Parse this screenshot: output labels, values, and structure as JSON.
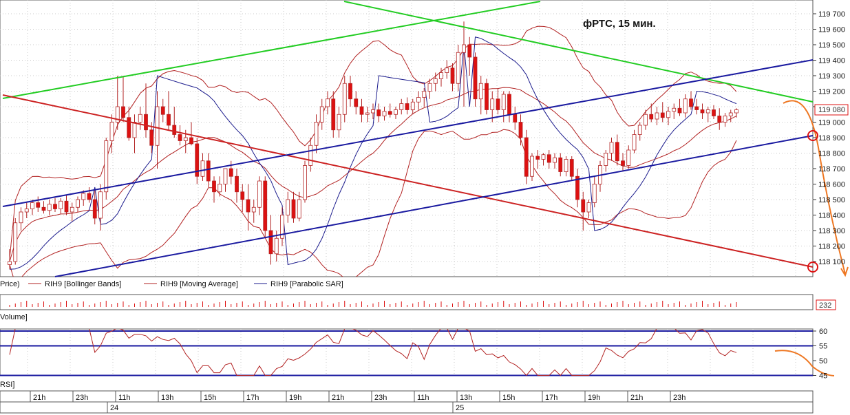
{
  "chart_data": {
    "type": "candlestick",
    "title": "фРТС, 15 мин.",
    "instrument": "RIH9",
    "price_axis_labels": [
      "119 700",
      "119 600",
      "119 500",
      "119 400",
      "119 300",
      "119 200",
      "119 100",
      "119 000",
      "118 900",
      "118 800",
      "118 700",
      "118 600",
      "118 500",
      "118 400",
      "118 300",
      "118 200",
      "118 100"
    ],
    "price_axis_values": [
      119700,
      119600,
      119500,
      119400,
      119300,
      119200,
      119100,
      119000,
      118900,
      118800,
      118700,
      118600,
      118500,
      118400,
      118300,
      118200,
      118100
    ],
    "last_price": "119 080",
    "last_volume": "232",
    "legend": [
      {
        "label": "Price)",
        "color": "#000000"
      },
      {
        "label": "RIH9 [Bollinger Bands]",
        "color": "#b22222"
      },
      {
        "label": "RIH9 [Moving Average]",
        "color": "#b22222"
      },
      {
        "label": "RIH9 [Parabolic SAR]",
        "color": "#1a1a8c"
      }
    ],
    "volume_label": "Volume]",
    "rsi_label": "RSI]",
    "rsi_axis_labels": [
      "60",
      "55",
      "50",
      "45"
    ],
    "rsi_axis_values": [
      60,
      55,
      50,
      45
    ],
    "time_labels": [
      "21h",
      "23h",
      "11h",
      "13h",
      "15h",
      "17h",
      "19h",
      "21h",
      "23h",
      "11h",
      "13h",
      "15h",
      "17h",
      "19h",
      "21h",
      "23h"
    ],
    "date_labels": [
      "24",
      "25"
    ],
    "candles": [
      {
        "o": 118080,
        "h": 118180,
        "l": 118050,
        "c": 118100
      },
      {
        "o": 118100,
        "h": 118380,
        "l": 118080,
        "c": 118350
      },
      {
        "o": 118350,
        "h": 118450,
        "l": 118300,
        "c": 118420
      },
      {
        "o": 118420,
        "h": 118480,
        "l": 118380,
        "c": 118440
      },
      {
        "o": 118440,
        "h": 118500,
        "l": 118400,
        "c": 118480
      },
      {
        "o": 118480,
        "h": 118520,
        "l": 118420,
        "c": 118450
      },
      {
        "o": 118450,
        "h": 118490,
        "l": 118410,
        "c": 118430
      },
      {
        "o": 118430,
        "h": 118500,
        "l": 118400,
        "c": 118470
      },
      {
        "o": 118470,
        "h": 118510,
        "l": 118420,
        "c": 118440
      },
      {
        "o": 118440,
        "h": 118510,
        "l": 118410,
        "c": 118490
      },
      {
        "o": 118490,
        "h": 118530,
        "l": 118400,
        "c": 118420
      },
      {
        "o": 118420,
        "h": 118480,
        "l": 118360,
        "c": 118450
      },
      {
        "o": 118450,
        "h": 118520,
        "l": 118420,
        "c": 118500
      },
      {
        "o": 118500,
        "h": 118560,
        "l": 118460,
        "c": 118540
      },
      {
        "o": 118540,
        "h": 118580,
        "l": 118480,
        "c": 118500
      },
      {
        "o": 118500,
        "h": 118560,
        "l": 118340,
        "c": 118380
      },
      {
        "o": 118380,
        "h": 118600,
        "l": 118300,
        "c": 118550
      },
      {
        "o": 118550,
        "h": 118900,
        "l": 118500,
        "c": 118880
      },
      {
        "o": 118880,
        "h": 119050,
        "l": 118800,
        "c": 119000
      },
      {
        "o": 119000,
        "h": 119300,
        "l": 118950,
        "c": 119100
      },
      {
        "o": 119100,
        "h": 119300,
        "l": 119000,
        "c": 119030
      },
      {
        "o": 119030,
        "h": 119100,
        "l": 118880,
        "c": 118900
      },
      {
        "o": 118900,
        "h": 119050,
        "l": 118800,
        "c": 119000
      },
      {
        "o": 119000,
        "h": 119100,
        "l": 118950,
        "c": 119050
      },
      {
        "o": 119050,
        "h": 119250,
        "l": 118900,
        "c": 118950
      },
      {
        "o": 118950,
        "h": 119000,
        "l": 118800,
        "c": 118850
      },
      {
        "o": 118850,
        "h": 119200,
        "l": 118700,
        "c": 119100
      },
      {
        "o": 119100,
        "h": 119150,
        "l": 119000,
        "c": 119050
      },
      {
        "o": 119050,
        "h": 119200,
        "l": 118950,
        "c": 118980
      },
      {
        "o": 118980,
        "h": 119100,
        "l": 118900,
        "c": 118920
      },
      {
        "o": 118920,
        "h": 118980,
        "l": 118850,
        "c": 118880
      },
      {
        "o": 118880,
        "h": 118950,
        "l": 118800,
        "c": 118900
      },
      {
        "o": 118900,
        "h": 119000,
        "l": 118850,
        "c": 118860
      },
      {
        "o": 118860,
        "h": 118900,
        "l": 118600,
        "c": 118650
      },
      {
        "o": 118650,
        "h": 118800,
        "l": 118620,
        "c": 118750
      },
      {
        "o": 118750,
        "h": 118800,
        "l": 118580,
        "c": 118620
      },
      {
        "o": 118620,
        "h": 118650,
        "l": 118480,
        "c": 118550
      },
      {
        "o": 118550,
        "h": 118650,
        "l": 118520,
        "c": 118600
      },
      {
        "o": 118600,
        "h": 118700,
        "l": 118550,
        "c": 118700
      },
      {
        "o": 118700,
        "h": 118750,
        "l": 118600,
        "c": 118650
      },
      {
        "o": 118650,
        "h": 118700,
        "l": 118480,
        "c": 118550
      },
      {
        "o": 118550,
        "h": 118600,
        "l": 118420,
        "c": 118500
      },
      {
        "o": 118500,
        "h": 118600,
        "l": 118300,
        "c": 118420
      },
      {
        "o": 118420,
        "h": 118500,
        "l": 118350,
        "c": 118450
      },
      {
        "o": 118450,
        "h": 118650,
        "l": 118400,
        "c": 118620
      },
      {
        "o": 118620,
        "h": 118650,
        "l": 118250,
        "c": 118300
      },
      {
        "o": 118300,
        "h": 118400,
        "l": 118080,
        "c": 118150
      },
      {
        "o": 118150,
        "h": 118300,
        "l": 118100,
        "c": 118250
      },
      {
        "o": 118250,
        "h": 118450,
        "l": 118200,
        "c": 118400
      },
      {
        "o": 118400,
        "h": 118550,
        "l": 118350,
        "c": 118500
      },
      {
        "o": 118500,
        "h": 118550,
        "l": 118350,
        "c": 118380
      },
      {
        "o": 118380,
        "h": 118550,
        "l": 118360,
        "c": 118500
      },
      {
        "o": 118500,
        "h": 118750,
        "l": 118480,
        "c": 118720
      },
      {
        "o": 118720,
        "h": 118900,
        "l": 118680,
        "c": 118850
      },
      {
        "o": 118850,
        "h": 119050,
        "l": 118800,
        "c": 119000
      },
      {
        "o": 119000,
        "h": 119150,
        "l": 118950,
        "c": 119100
      },
      {
        "o": 119100,
        "h": 119200,
        "l": 119050,
        "c": 119150
      },
      {
        "o": 119150,
        "h": 119200,
        "l": 118900,
        "c": 118950
      },
      {
        "o": 118950,
        "h": 119100,
        "l": 118900,
        "c": 119050
      },
      {
        "o": 119050,
        "h": 119300,
        "l": 119000,
        "c": 119250
      },
      {
        "o": 119250,
        "h": 119300,
        "l": 119100,
        "c": 119150
      },
      {
        "o": 119150,
        "h": 119200,
        "l": 119050,
        "c": 119100
      },
      {
        "o": 119100,
        "h": 119150,
        "l": 119000,
        "c": 119050
      },
      {
        "o": 119050,
        "h": 119100,
        "l": 119000,
        "c": 119060
      },
      {
        "o": 119060,
        "h": 119120,
        "l": 119020,
        "c": 119080
      },
      {
        "o": 119080,
        "h": 119120,
        "l": 119000,
        "c": 119040
      },
      {
        "o": 119040,
        "h": 119100,
        "l": 119010,
        "c": 119070
      },
      {
        "o": 119070,
        "h": 119120,
        "l": 119030,
        "c": 119050
      },
      {
        "o": 119050,
        "h": 119100,
        "l": 119020,
        "c": 119080
      },
      {
        "o": 119080,
        "h": 119150,
        "l": 119050,
        "c": 119120
      },
      {
        "o": 119120,
        "h": 119160,
        "l": 119050,
        "c": 119080
      },
      {
        "o": 119080,
        "h": 119150,
        "l": 119050,
        "c": 119130
      },
      {
        "o": 119130,
        "h": 119200,
        "l": 119080,
        "c": 119160
      },
      {
        "o": 119160,
        "h": 119220,
        "l": 119100,
        "c": 119200
      },
      {
        "o": 119200,
        "h": 119280,
        "l": 119150,
        "c": 119250
      },
      {
        "o": 119250,
        "h": 119320,
        "l": 119200,
        "c": 119280
      },
      {
        "o": 119280,
        "h": 119350,
        "l": 119230,
        "c": 119320
      },
      {
        "o": 119320,
        "h": 119400,
        "l": 119280,
        "c": 119350
      },
      {
        "o": 119350,
        "h": 119380,
        "l": 119200,
        "c": 119250
      },
      {
        "o": 119250,
        "h": 119500,
        "l": 119200,
        "c": 119450
      },
      {
        "o": 119450,
        "h": 119650,
        "l": 119100,
        "c": 119500
      },
      {
        "o": 119500,
        "h": 119550,
        "l": 119300,
        "c": 119420
      },
      {
        "o": 119420,
        "h": 119450,
        "l": 119100,
        "c": 119150
      },
      {
        "o": 119150,
        "h": 119300,
        "l": 119050,
        "c": 119250
      },
      {
        "o": 119250,
        "h": 119280,
        "l": 119050,
        "c": 119080
      },
      {
        "o": 119080,
        "h": 119200,
        "l": 119000,
        "c": 119150
      },
      {
        "o": 119150,
        "h": 119220,
        "l": 119050,
        "c": 119080
      },
      {
        "o": 119080,
        "h": 119200,
        "l": 119000,
        "c": 119180
      },
      {
        "o": 119180,
        "h": 119200,
        "l": 119000,
        "c": 119050
      },
      {
        "o": 119050,
        "h": 119100,
        "l": 118950,
        "c": 119000
      },
      {
        "o": 119000,
        "h": 119050,
        "l": 118850,
        "c": 118900
      },
      {
        "o": 118900,
        "h": 118950,
        "l": 118600,
        "c": 118650
      },
      {
        "o": 118650,
        "h": 118800,
        "l": 118620,
        "c": 118780
      },
      {
        "o": 118780,
        "h": 118820,
        "l": 118700,
        "c": 118760
      },
      {
        "o": 118760,
        "h": 118800,
        "l": 118720,
        "c": 118790
      },
      {
        "o": 118790,
        "h": 118820,
        "l": 118700,
        "c": 118740
      },
      {
        "o": 118740,
        "h": 118800,
        "l": 118700,
        "c": 118770
      },
      {
        "o": 118770,
        "h": 118800,
        "l": 118650,
        "c": 118680
      },
      {
        "o": 118680,
        "h": 118780,
        "l": 118650,
        "c": 118760
      },
      {
        "o": 118760,
        "h": 118780,
        "l": 118620,
        "c": 118650
      },
      {
        "o": 118650,
        "h": 118700,
        "l": 118450,
        "c": 118500
      },
      {
        "o": 118500,
        "h": 118550,
        "l": 118300,
        "c": 118420
      },
      {
        "o": 118420,
        "h": 118500,
        "l": 118380,
        "c": 118480
      },
      {
        "o": 118480,
        "h": 118650,
        "l": 118450,
        "c": 118600
      },
      {
        "o": 118600,
        "h": 118750,
        "l": 118550,
        "c": 118720
      },
      {
        "o": 118720,
        "h": 118820,
        "l": 118680,
        "c": 118800
      },
      {
        "o": 118800,
        "h": 118900,
        "l": 118750,
        "c": 118870
      },
      {
        "o": 118870,
        "h": 118920,
        "l": 118720,
        "c": 118750
      },
      {
        "o": 118750,
        "h": 118800,
        "l": 118680,
        "c": 118720
      },
      {
        "o": 118720,
        "h": 118850,
        "l": 118700,
        "c": 118820
      },
      {
        "o": 118820,
        "h": 118950,
        "l": 118800,
        "c": 118920
      },
      {
        "o": 118920,
        "h": 119000,
        "l": 118880,
        "c": 118980
      },
      {
        "o": 118980,
        "h": 119080,
        "l": 118950,
        "c": 119050
      },
      {
        "o": 119050,
        "h": 119120,
        "l": 119000,
        "c": 119020
      },
      {
        "o": 119020,
        "h": 119100,
        "l": 118980,
        "c": 119060
      },
      {
        "o": 119060,
        "h": 119130,
        "l": 119000,
        "c": 119030
      },
      {
        "o": 119030,
        "h": 119100,
        "l": 118980,
        "c": 119070
      },
      {
        "o": 119070,
        "h": 119120,
        "l": 119020,
        "c": 119090
      },
      {
        "o": 119090,
        "h": 119150,
        "l": 119040,
        "c": 119060
      },
      {
        "o": 119060,
        "h": 119180,
        "l": 119030,
        "c": 119150
      },
      {
        "o": 119150,
        "h": 119200,
        "l": 119080,
        "c": 119100
      },
      {
        "o": 119100,
        "h": 119150,
        "l": 119050,
        "c": 119080
      },
      {
        "o": 119080,
        "h": 119120,
        "l": 119020,
        "c": 119060
      },
      {
        "o": 119060,
        "h": 119100,
        "l": 119000,
        "c": 119080
      },
      {
        "o": 119080,
        "h": 119110,
        "l": 119020,
        "c": 119040
      },
      {
        "o": 119040,
        "h": 119090,
        "l": 118950,
        "c": 119000
      },
      {
        "o": 119000,
        "h": 119060,
        "l": 118970,
        "c": 119040
      },
      {
        "o": 119040,
        "h": 119080,
        "l": 119000,
        "c": 119060
      },
      {
        "o": 119060,
        "h": 119090,
        "l": 119030,
        "c": 119080
      }
    ],
    "trend_lines": [
      {
        "name": "green-upper-rising",
        "color": "#22cc22"
      },
      {
        "name": "green-falling",
        "color": "#22cc22"
      },
      {
        "name": "red-falling",
        "color": "#cc2222"
      },
      {
        "name": "blue-upper-channel",
        "color": "#1a1aa0"
      },
      {
        "name": "blue-lower-channel",
        "color": "#1a1aa0"
      }
    ],
    "projection_color": "#ee7722",
    "colors": {
      "bull": "#ffffff",
      "bear": "#dd1111",
      "candle_edge": "#b22222",
      "grid": "#c8c8c8",
      "bands": "#b22222",
      "sar": "#1a1a8c",
      "rsi_line": "#b22222",
      "rsi_levels": "#1a1aa0",
      "price_box": "#dd1111",
      "circle": "#dd1111"
    }
  }
}
